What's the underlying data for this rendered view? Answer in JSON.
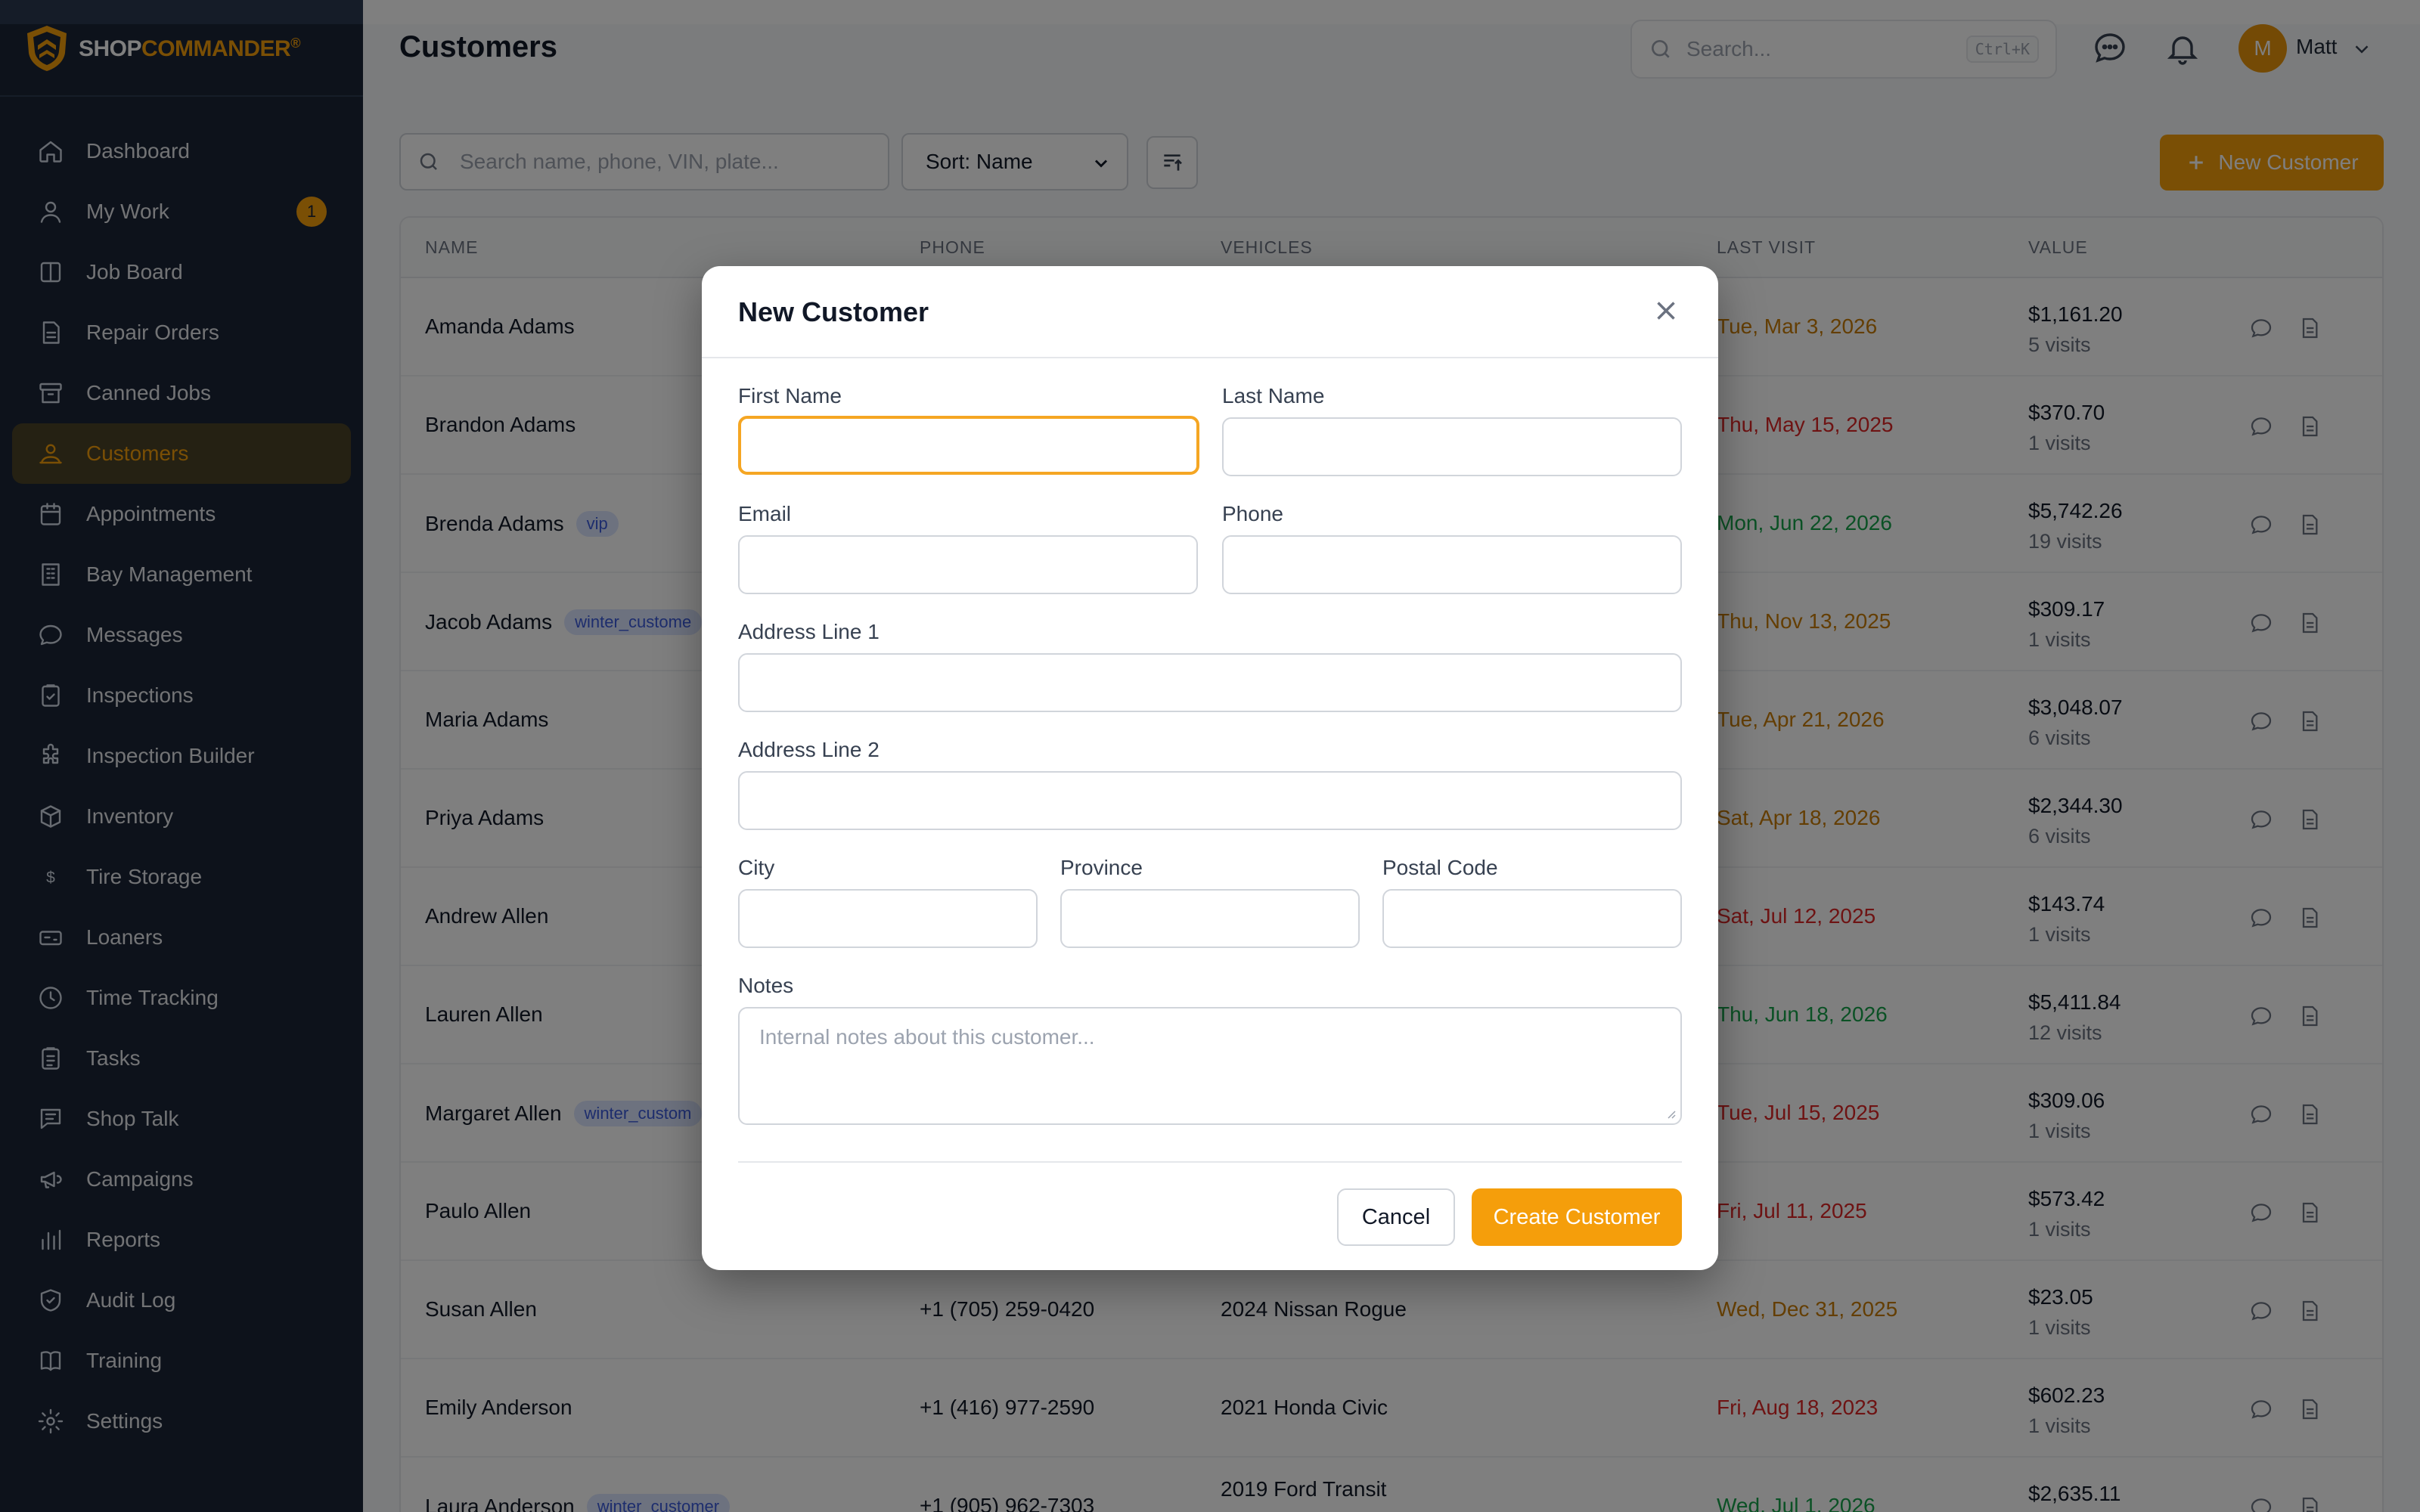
{
  "brand": {
    "name_part1": "SHOP",
    "name_part2": "COMMANDER",
    "mark": "®"
  },
  "sidebar": {
    "items": [
      {
        "label": "Dashboard",
        "icon": "home-icon"
      },
      {
        "label": "My Work",
        "icon": "user-icon",
        "badge": "1"
      },
      {
        "label": "Job Board",
        "icon": "columns-icon"
      },
      {
        "label": "Repair Orders",
        "icon": "file-icon"
      },
      {
        "label": "Canned Jobs",
        "icon": "archive-icon"
      },
      {
        "label": "Customers",
        "icon": "users-icon",
        "active": true
      },
      {
        "label": "Appointments",
        "icon": "calendar-icon"
      },
      {
        "label": "Bay Management",
        "icon": "building-icon"
      },
      {
        "label": "Messages",
        "icon": "chat-icon"
      },
      {
        "label": "Inspections",
        "icon": "clipboard-check-icon"
      },
      {
        "label": "Inspection Builder",
        "icon": "puzzle-icon"
      },
      {
        "label": "Inventory",
        "icon": "box-icon"
      },
      {
        "label": "Tire Storage",
        "icon": "dollar-icon"
      },
      {
        "label": "Loaners",
        "icon": "car-icon"
      },
      {
        "label": "Time Tracking",
        "icon": "clock-icon"
      },
      {
        "label": "Tasks",
        "icon": "clipboard-icon"
      },
      {
        "label": "Shop Talk",
        "icon": "message-square-icon"
      },
      {
        "label": "Campaigns",
        "icon": "megaphone-icon"
      },
      {
        "label": "Reports",
        "icon": "bar-chart-icon"
      },
      {
        "label": "Audit Log",
        "icon": "shield-icon"
      },
      {
        "label": "Training",
        "icon": "book-icon"
      },
      {
        "label": "Settings",
        "icon": "gear-icon"
      }
    ]
  },
  "header": {
    "title": "Customers",
    "search_placeholder": "Search...",
    "search_shortcut": "Ctrl+K",
    "user_initial": "M",
    "user_name": "Matt"
  },
  "toolbar": {
    "search_placeholder": "Search name, phone, VIN, plate...",
    "sort_label": "Sort: Name",
    "new_customer_label": "New Customer"
  },
  "table": {
    "headers": [
      "NAME",
      "PHONE",
      "VEHICLES",
      "LAST VISIT",
      "VALUE"
    ],
    "rows": [
      {
        "name": "Amanda Adams",
        "tag": "",
        "phone": "",
        "vehicle": "",
        "last_visit": "Tue, Mar 3, 2026",
        "visit_status": "amber",
        "value": "$1,161.20",
        "visits": "5 visits"
      },
      {
        "name": "Brandon Adams",
        "tag": "",
        "phone": "",
        "vehicle": "",
        "last_visit": "Thu, May 15, 2025",
        "visit_status": "red",
        "value": "$370.70",
        "visits": "1 visits"
      },
      {
        "name": "Brenda Adams",
        "tag": "vip",
        "phone": "",
        "vehicle": "",
        "last_visit": "Mon, Jun 22, 2026",
        "visit_status": "green",
        "value": "$5,742.26",
        "visits": "19 visits"
      },
      {
        "name": "Jacob Adams",
        "tag": "winter_custome",
        "phone": "",
        "vehicle": "",
        "last_visit": "Thu, Nov 13, 2025",
        "visit_status": "amber",
        "value": "$309.17",
        "visits": "1 visits"
      },
      {
        "name": "Maria Adams",
        "tag": "",
        "phone": "",
        "vehicle": "",
        "last_visit": "Tue, Apr 21, 2026",
        "visit_status": "amber",
        "value": "$3,048.07",
        "visits": "6 visits"
      },
      {
        "name": "Priya Adams",
        "tag": "",
        "phone": "",
        "vehicle": "",
        "last_visit": "Sat, Apr 18, 2026",
        "visit_status": "amber",
        "value": "$2,344.30",
        "visits": "6 visits"
      },
      {
        "name": "Andrew Allen",
        "tag": "",
        "phone": "",
        "vehicle": "",
        "last_visit": "Sat, Jul 12, 2025",
        "visit_status": "red",
        "value": "$143.74",
        "visits": "1 visits"
      },
      {
        "name": "Lauren Allen",
        "tag": "",
        "phone": "",
        "vehicle": "",
        "last_visit": "Thu, Jun 18, 2026",
        "visit_status": "green",
        "value": "$5,411.84",
        "visits": "12 visits"
      },
      {
        "name": "Margaret Allen",
        "tag": "winter_custom",
        "phone": "",
        "vehicle": "",
        "last_visit": "Tue, Jul 15, 2025",
        "visit_status": "red",
        "value": "$309.06",
        "visits": "1 visits"
      },
      {
        "name": "Paulo Allen",
        "tag": "",
        "phone": "",
        "vehicle": "",
        "last_visit": "Fri, Jul 11, 2025",
        "visit_status": "red",
        "value": "$573.42",
        "visits": "1 visits"
      },
      {
        "name": "Susan Allen",
        "tag": "",
        "phone": "+1 (705) 259-0420",
        "vehicle": "2024 Nissan Rogue",
        "last_visit": "Wed, Dec 31, 2025",
        "visit_status": "amber",
        "value": "$23.05",
        "visits": "1 visits"
      },
      {
        "name": "Emily Anderson",
        "tag": "",
        "phone": "+1 (416) 977-2590",
        "vehicle": "2021 Honda Civic",
        "last_visit": "Fri, Aug 18, 2023",
        "visit_status": "red",
        "value": "$602.23",
        "visits": "1 visits"
      },
      {
        "name": "Laura Anderson",
        "tag": "winter_customer",
        "phone": "+1 (905) 962-7303",
        "vehicle": "2019 Ford Transit",
        "last_visit": "Wed, Jul 1, 2026",
        "visit_status": "green",
        "value": "$2,635.11",
        "visits": ""
      }
    ]
  },
  "modal": {
    "title": "New Customer",
    "first_name_label": "First Name",
    "last_name_label": "Last Name",
    "email_label": "Email",
    "phone_label": "Phone",
    "address1_label": "Address Line 1",
    "address2_label": "Address Line 2",
    "city_label": "City",
    "province_label": "Province",
    "postal_label": "Postal Code",
    "notes_label": "Notes",
    "notes_placeholder": "Internal notes about this customer...",
    "cancel_label": "Cancel",
    "create_label": "Create Customer"
  },
  "colors": {
    "accent": "#f59e0b",
    "sidebar_bg": "#1b2536",
    "status_amber": "#c97c06",
    "status_red": "#dc2626",
    "status_green": "#16a34a",
    "tag_bg": "#dbe4ff"
  }
}
